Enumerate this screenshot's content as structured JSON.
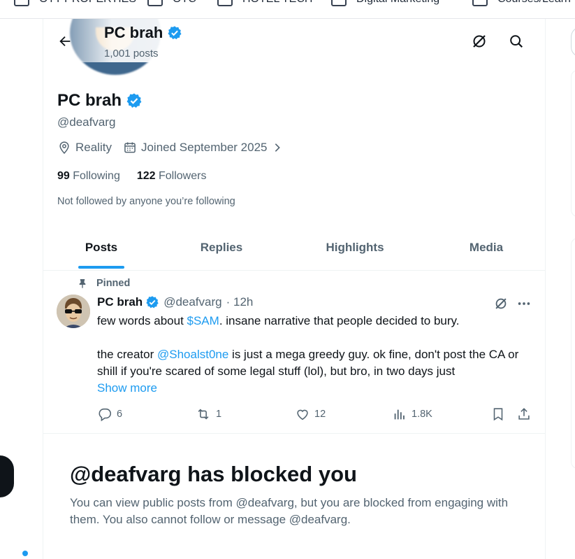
{
  "bookmarks": [
    {
      "label": "OTT PROPERTIES"
    },
    {
      "label": "OTC"
    },
    {
      "label": "HOTEL TECH"
    },
    {
      "label": "Digital Marketing"
    },
    {
      "label": "Courses/Learn"
    }
  ],
  "header": {
    "name": "PC brah",
    "posts_count": "1,001 posts",
    "icons": {
      "back": "back-arrow-icon",
      "grok": "grok-icon",
      "search": "search-icon"
    }
  },
  "profile": {
    "name": "PC brah",
    "handle": "@deafvarg",
    "location": "Reality",
    "joined": "Joined September 2025",
    "following_count": "99",
    "following_label": "Following",
    "followers_count": "122",
    "followers_label": "Followers",
    "not_followed_text": "Not followed by anyone you’re following"
  },
  "tabs": [
    {
      "label": "Posts",
      "active": true
    },
    {
      "label": "Replies",
      "active": false
    },
    {
      "label": "Highlights",
      "active": false
    },
    {
      "label": "Media",
      "active": false
    }
  ],
  "post": {
    "pinned_label": "Pinned",
    "author_name": "PC brah",
    "author_handle": "@deafvarg",
    "time": "· 12h",
    "line1_pre": "few words about ",
    "line1_link": "$SAM",
    "line1_post": ". insane narrative that people decided to bury.",
    "line2_pre": "the creator ",
    "line2_link": "@Shoalst0ne",
    "line2_post": " is just a mega greedy guy. ok fine, don't post the CA or shill if you're scared of some legal stuff (lol), but bro, in two days just",
    "show_more": "Show more",
    "replies": "6",
    "reposts": "1",
    "likes": "12",
    "views": "1.8K"
  },
  "blocked": {
    "title": "@deafvarg has blocked you",
    "text": "You can view public posts from @deafvarg, but you are blocked from engaging with them. You also cannot follow or message @deafvarg."
  },
  "colors": {
    "accent": "#1d9bf0",
    "text_primary": "#0f1419",
    "text_secondary": "#536471",
    "border": "#eff3f4"
  }
}
